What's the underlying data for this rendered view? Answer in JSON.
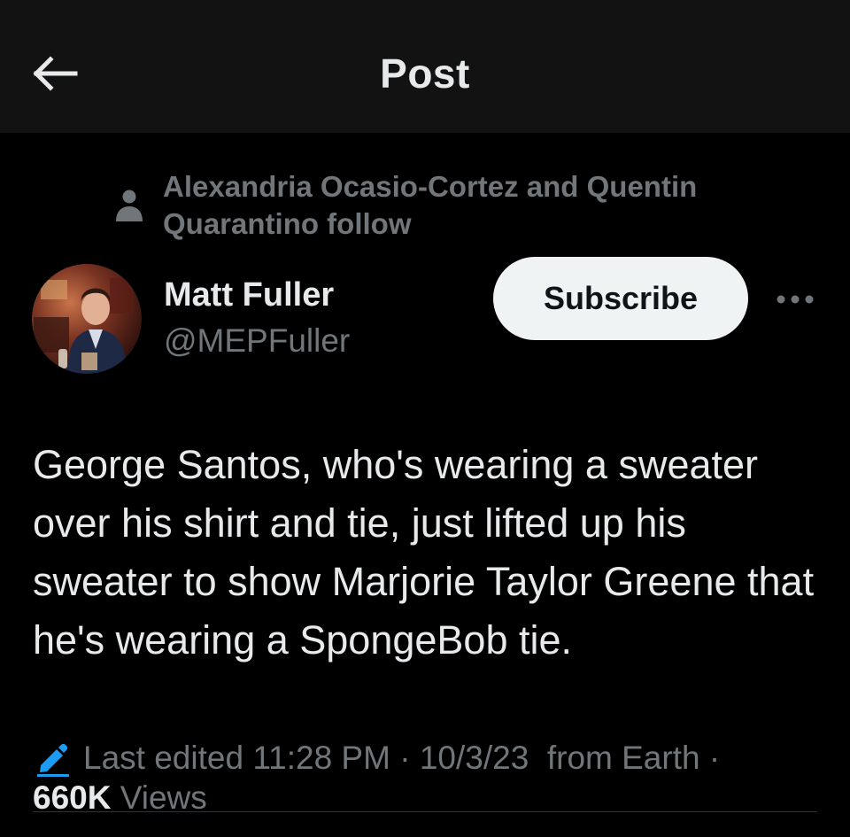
{
  "header": {
    "title": "Post"
  },
  "social_context": {
    "text": "Alexandria Ocasio-Cortez and Quentin Quarantino follow"
  },
  "author": {
    "name": "Matt Fuller",
    "handle": "@MEPFuller"
  },
  "actions": {
    "subscribe_label": "Subscribe"
  },
  "post": {
    "text": "George Santos, who's wearing a sweater over his shirt and tie, just lifted up his sweater to show Marjorie Taylor Greene that he's wearing a SpongeBob tie."
  },
  "meta": {
    "edited_label": "Last edited",
    "time": "11:28 PM",
    "date": "10/3/23",
    "location": "from Earth",
    "views_count": "660K",
    "views_label": "Views"
  },
  "icons": {
    "back": "arrow-left-icon",
    "person": "person-icon",
    "more": "more-dots-icon",
    "edit": "pencil-icon"
  },
  "colors": {
    "background": "#000000",
    "header_background": "#121212",
    "primary_text": "#e7e9ea",
    "secondary_text": "#71767b",
    "button_bg": "#eff3f4",
    "edit_icon": "#1d9bf0"
  }
}
